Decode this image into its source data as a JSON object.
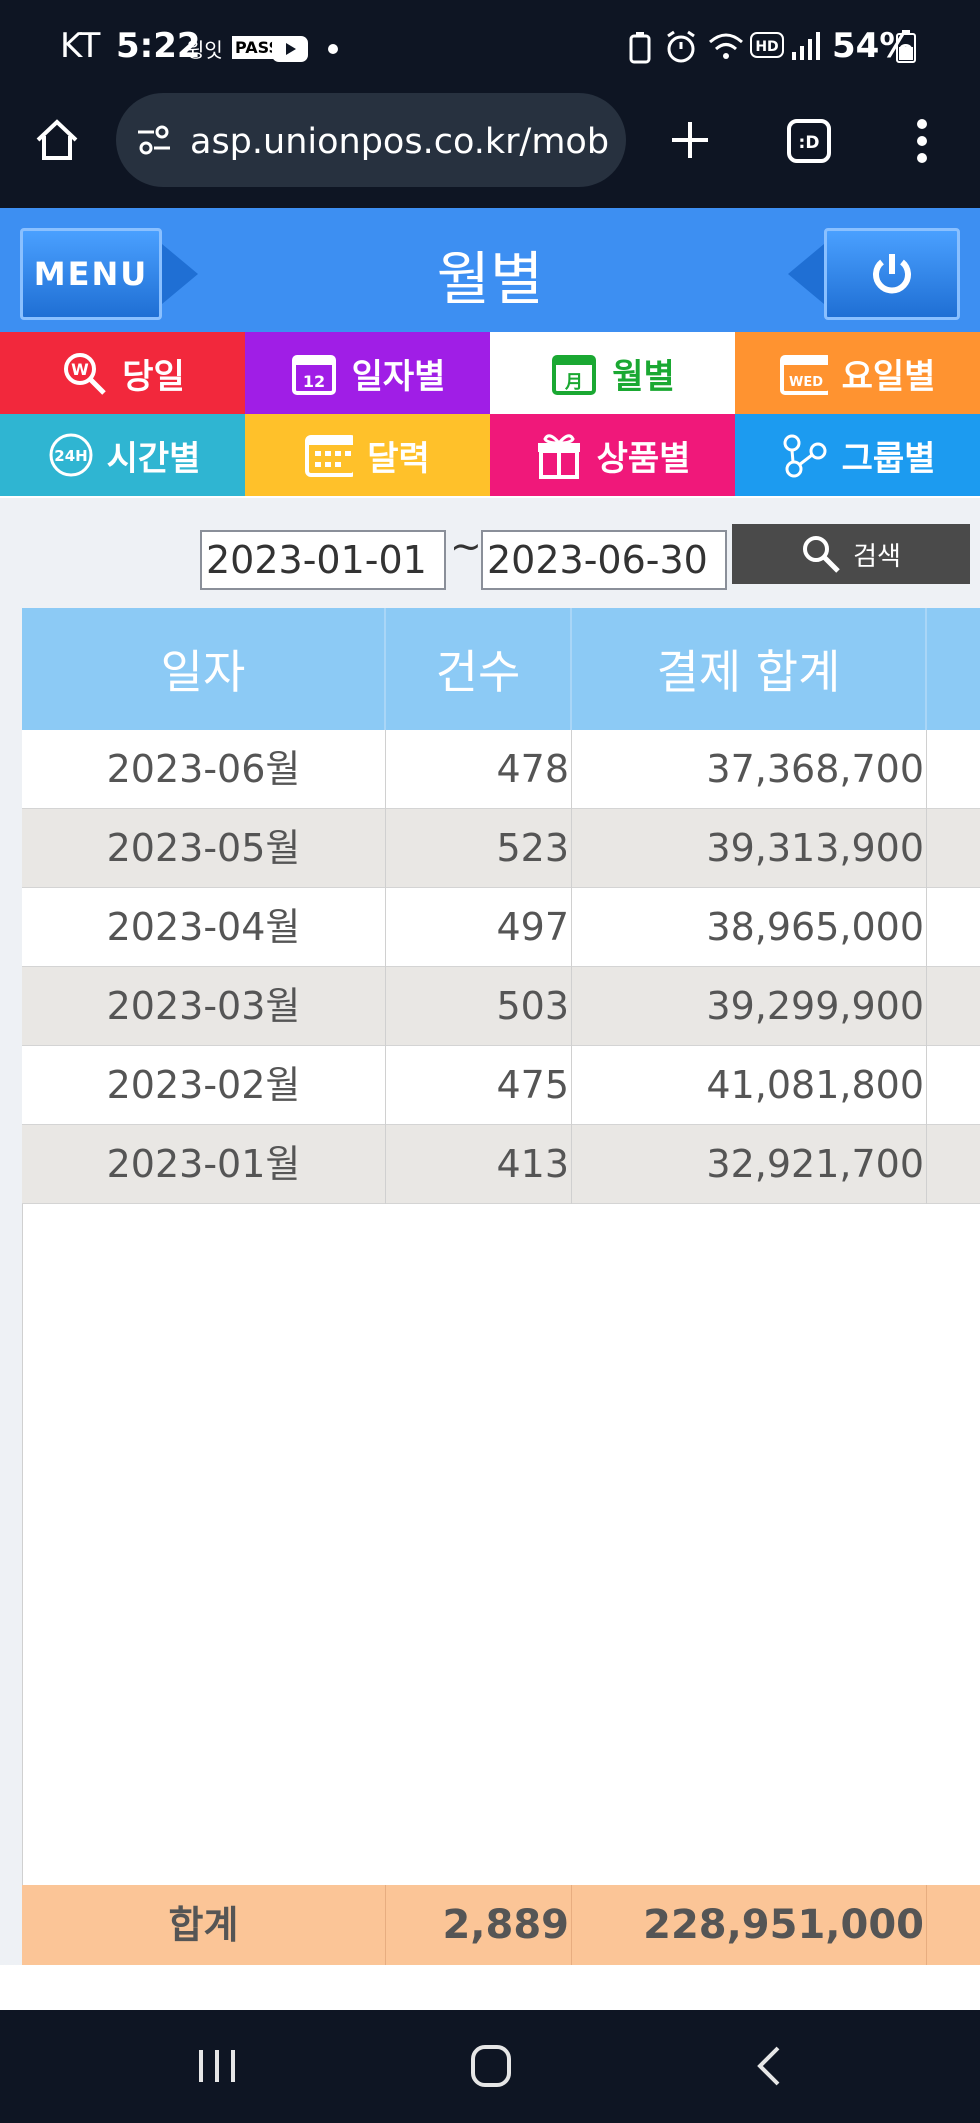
{
  "status": {
    "carrier": "KT",
    "time": "5:22",
    "app1": "윙잇",
    "app2": "PASS",
    "battery": "54%"
  },
  "browser": {
    "url": "asp.unionpos.co.kr/mobile/"
  },
  "header": {
    "menu_label": "MENU",
    "title": "월별"
  },
  "tabs": [
    {
      "label": "당일",
      "color": "#f2283c",
      "icon": "won-search-icon"
    },
    {
      "label": "일자별",
      "color": "#a01ee6",
      "icon": "calendar-12-icon"
    },
    {
      "label": "월별",
      "color": "#ffffff",
      "icon": "calendar-month-icon",
      "active": true
    },
    {
      "label": "요일별",
      "color": "#ff9330",
      "icon": "calendar-wed-icon"
    },
    {
      "label": "시간별",
      "color": "#2fb5d2",
      "icon": "clock-24h-icon"
    },
    {
      "label": "달력",
      "color": "#ffc12a",
      "icon": "calendar-grid-icon"
    },
    {
      "label": "상품별",
      "color": "#f0187a",
      "icon": "gift-icon"
    },
    {
      "label": "그룹별",
      "color": "#1c9bf0",
      "icon": "group-nodes-icon"
    }
  ],
  "filter": {
    "start_date": "2023-01-01",
    "separator": "~",
    "end_date": "2023-06-30",
    "search_label": "검색"
  },
  "table": {
    "headers": [
      "일자",
      "건수",
      "결제 합계"
    ],
    "rows": [
      {
        "date": "2023-06월",
        "count": "478",
        "total": "37,368,700"
      },
      {
        "date": "2023-05월",
        "count": "523",
        "total": "39,313,900"
      },
      {
        "date": "2023-04월",
        "count": "497",
        "total": "38,965,000"
      },
      {
        "date": "2023-03월",
        "count": "503",
        "total": "39,299,900"
      },
      {
        "date": "2023-02월",
        "count": "475",
        "total": "41,081,800"
      },
      {
        "date": "2023-01월",
        "count": "413",
        "total": "32,921,700"
      }
    ],
    "footer": {
      "label": "합계",
      "count": "2,889",
      "total": "228,951,000"
    }
  }
}
